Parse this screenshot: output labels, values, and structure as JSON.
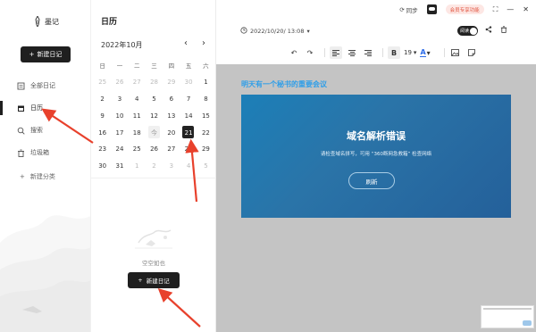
{
  "app": {
    "name": "墨记"
  },
  "sidebar": {
    "new_diary_label": "新建日记",
    "items": [
      {
        "label": "全部日记",
        "icon": "note-icon",
        "active": false
      },
      {
        "label": "日历",
        "icon": "calendar-icon",
        "active": true
      },
      {
        "label": "搜索",
        "icon": "search-icon",
        "active": false
      },
      {
        "label": "垃圾箱",
        "icon": "trash-icon",
        "active": false
      }
    ],
    "new_category_label": "新建分类"
  },
  "calendar": {
    "title": "日历",
    "month_label": "2022年10月",
    "weekdays": [
      "日",
      "一",
      "二",
      "三",
      "四",
      "五",
      "六"
    ],
    "weeks": [
      [
        "25",
        "26",
        "27",
        "28",
        "29",
        "30",
        "1"
      ],
      [
        "2",
        "3",
        "4",
        "5",
        "6",
        "7",
        "8"
      ],
      [
        "9",
        "10",
        "11",
        "12",
        "13",
        "14",
        "15"
      ],
      [
        "16",
        "17",
        "18",
        "19",
        "20",
        "21",
        "22"
      ],
      [
        "23",
        "24",
        "25",
        "26",
        "27",
        "28",
        "29"
      ],
      [
        "30",
        "31",
        "1",
        "2",
        "3",
        "4",
        "5"
      ]
    ],
    "today_marker": "今",
    "selected_day": "21",
    "empty_text": "空空如也",
    "new_diary_label": "新建日记"
  },
  "header": {
    "sync_label": "同步",
    "vip_label": "会员专享功能",
    "datetime": "2022/10/20/ 13:08",
    "read_mode_label": "阅读",
    "font_size": "19"
  },
  "document": {
    "title": "明天有一个秘书的重要会议",
    "error_title": "域名解析错误",
    "error_desc": "请检查域名拼写，可用 “360断网急救箱” 检查网络",
    "refresh_label": "刷新"
  },
  "colors": {
    "accent": "#1f1f1f",
    "title_blue": "#2f9ee8",
    "annotation_red": "#e8412c",
    "error_bg": "#1e72ad",
    "canvas_gray": "#c4c4c4"
  }
}
